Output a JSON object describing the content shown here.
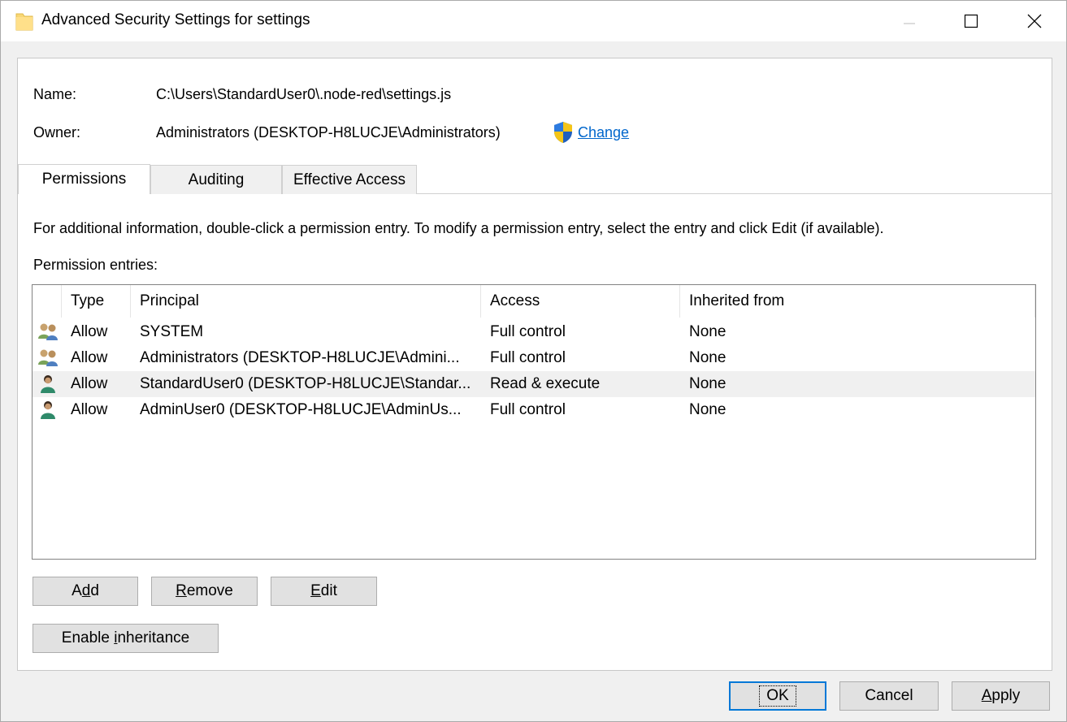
{
  "window": {
    "title": "Advanced Security Settings for settings",
    "icon": "folder-icon"
  },
  "info": {
    "name_label": "Name:",
    "name_value": "C:\\Users\\StandardUser0\\.node-red\\settings.js",
    "owner_label": "Owner:",
    "owner_value": "Administrators (DESKTOP-H8LUCJE\\Administrators)",
    "change_link": "Change"
  },
  "tabs": [
    {
      "label": "Permissions",
      "active": true
    },
    {
      "label": "Auditing",
      "active": false
    },
    {
      "label": "Effective Access",
      "active": false
    }
  ],
  "instructions": "For additional information, double-click a permission entry. To modify a permission entry, select the entry and click Edit (if available).",
  "entries_label": "Permission entries:",
  "table": {
    "headers": [
      "Type",
      "Principal",
      "Access",
      "Inherited from"
    ],
    "rows": [
      {
        "icon": "user-group-icon",
        "type": "Allow",
        "principal": "SYSTEM",
        "access": "Full control",
        "inherited": "None",
        "selected": false
      },
      {
        "icon": "user-group-icon",
        "type": "Allow",
        "principal": "Administrators (DESKTOP-H8LUCJE\\Admini...",
        "access": "Full control",
        "inherited": "None",
        "selected": false
      },
      {
        "icon": "user-icon",
        "type": "Allow",
        "principal": "StandardUser0 (DESKTOP-H8LUCJE\\Standar...",
        "access": "Read & execute",
        "inherited": "None",
        "selected": true
      },
      {
        "icon": "user-icon",
        "type": "Allow",
        "principal": "AdminUser0 (DESKTOP-H8LUCJE\\AdminUs...",
        "access": "Full control",
        "inherited": "None",
        "selected": false
      }
    ]
  },
  "buttons": {
    "add_pre": "A",
    "add_ul": "d",
    "add_post": "d",
    "remove_pre": "",
    "remove_ul": "R",
    "remove_post": "emove",
    "edit_pre": "",
    "edit_ul": "E",
    "edit_post": "dit",
    "inherit_pre": "Enable ",
    "inherit_ul": "i",
    "inherit_post": "nheritance",
    "ok": "OK",
    "cancel": "Cancel",
    "apply_pre": "",
    "apply_ul": "A",
    "apply_post": "pply"
  },
  "colors": {
    "link": "#0066cc",
    "default_button_border": "#0078d7",
    "selected_row": "#f0f0f0"
  }
}
